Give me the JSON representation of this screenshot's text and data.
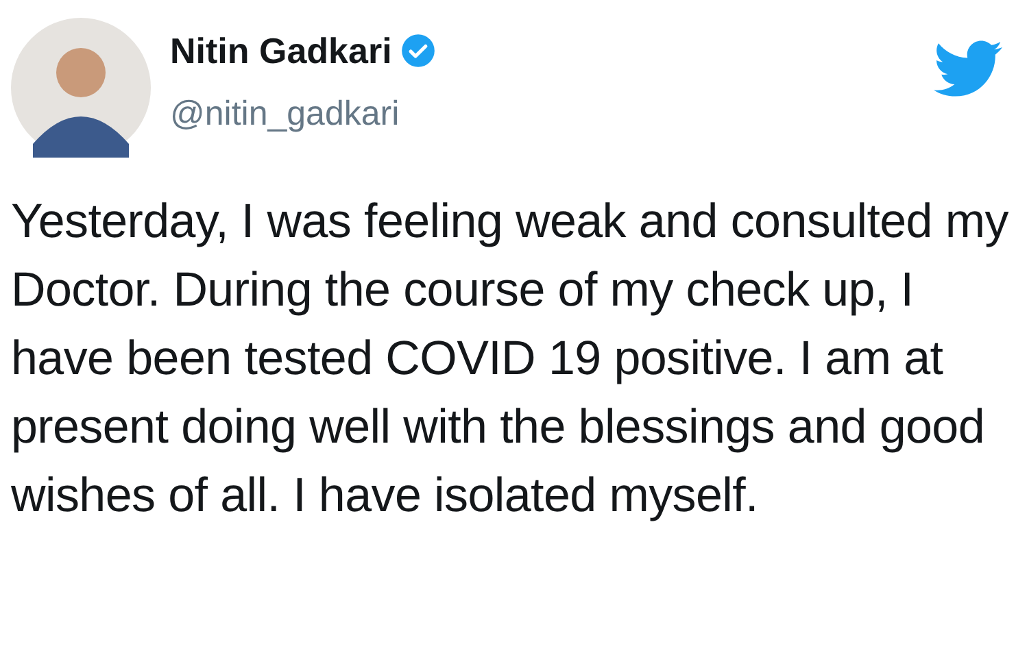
{
  "author": {
    "name": "Nitin Gadkari",
    "verified": true,
    "handle": "@nitin_gadkari"
  },
  "tweet": {
    "text": "Yesterday, I was feeling weak and consulted my Doctor. During the course of my check up, I have been tested COVID 19 positive. I am at present doing well with the blessings and good wishes of all. I have isolated myself."
  }
}
